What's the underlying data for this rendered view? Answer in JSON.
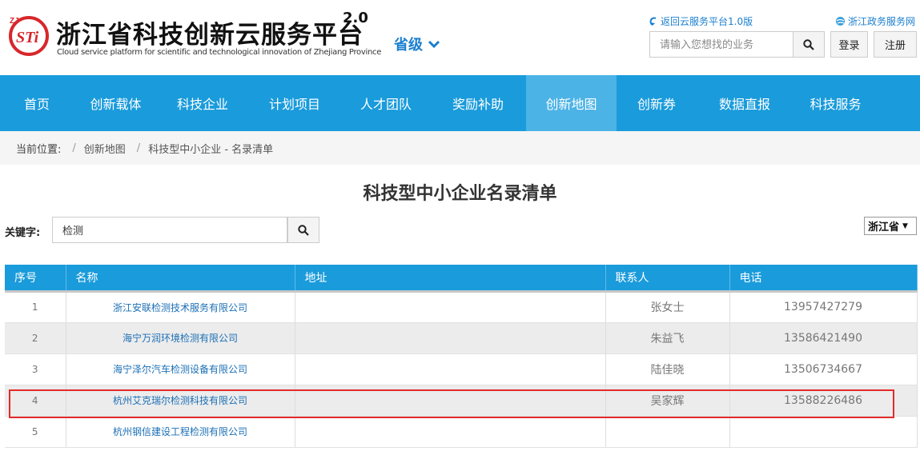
{
  "header": {
    "title": "浙江省科技创新云服务平台",
    "version": "2.0",
    "subtitle": "Cloud service platform for scientific and technological innovation of Zhejiang Province",
    "level": "省级",
    "back_link": "返回云服务平台1.0版",
    "gov_link": "浙江政务服务网",
    "search_placeholder": "请输入您想找的业务",
    "login": "登录",
    "register": "注册"
  },
  "nav": {
    "items": [
      {
        "label": "首页",
        "active": false
      },
      {
        "label": "创新载体",
        "active": false
      },
      {
        "label": "科技企业",
        "active": false
      },
      {
        "label": "计划项目",
        "active": false
      },
      {
        "label": "人才团队",
        "active": false
      },
      {
        "label": "奖励补助",
        "active": false
      },
      {
        "label": "创新地图",
        "active": true
      },
      {
        "label": "创新券",
        "active": false
      },
      {
        "label": "数据直报",
        "active": false
      },
      {
        "label": "科技服务",
        "active": false
      }
    ]
  },
  "breadcrumb": {
    "label": "当前位置:",
    "items": [
      "创新地图",
      "科技型中小企业 - 名录清单"
    ]
  },
  "page": {
    "title": "科技型中小企业名录清单",
    "keyword_label": "关键字:",
    "keyword_value": "检测",
    "province": "浙江省"
  },
  "table": {
    "headers": [
      "序号",
      "名称",
      "地址",
      "联系人",
      "电话"
    ],
    "rows": [
      {
        "no": "1",
        "name": "浙江安联检测技术服务有限公司",
        "address": "",
        "contact": "张女士",
        "phone": "13957427279"
      },
      {
        "no": "2",
        "name": "海宁万润环境检测有限公司",
        "address": "",
        "contact": "朱益飞",
        "phone": "13586421490"
      },
      {
        "no": "3",
        "name": "海宁泽尔汽车检测设备有限公司",
        "address": "",
        "contact": "陆佳晓",
        "phone": "13506734667"
      },
      {
        "no": "4",
        "name": "杭州艾克瑞尔检测科技有限公司",
        "address": "",
        "contact": "吴家辉",
        "phone": "13588226486"
      },
      {
        "no": "5",
        "name": "杭州钢信建设工程检测有限公司",
        "address": "",
        "contact": "",
        "phone": ""
      }
    ]
  },
  "colors": {
    "nav_bg": "#1a9bdb",
    "nav_active": "#4cb3e6",
    "link": "#1b6fb5",
    "logo_red": "#d8262b",
    "highlight": "#e32b2b"
  }
}
